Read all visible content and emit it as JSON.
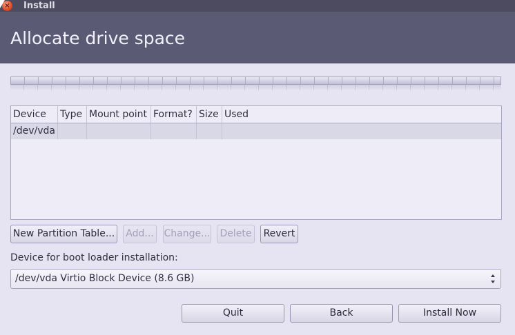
{
  "window": {
    "title": "Install",
    "close_icon": "close-icon"
  },
  "header": {
    "title": "Allocate drive space"
  },
  "table": {
    "columns": [
      "Device",
      "Type",
      "Mount point",
      "Format?",
      "Size",
      "Used"
    ],
    "rows": [
      {
        "device": "/dev/vda",
        "type": "",
        "mount": "",
        "format": "",
        "size": "",
        "used": ""
      }
    ]
  },
  "partition_buttons": {
    "new_table": "New Partition Table...",
    "add": "Add...",
    "change": "Change...",
    "delete": "Delete",
    "revert": "Revert"
  },
  "bootloader": {
    "label": "Device for boot loader installation:",
    "selected": "/dev/vda Virtio Block Device (8.6 GB)"
  },
  "footer": {
    "quit": "Quit",
    "back": "Back",
    "install": "Install Now"
  },
  "colors": {
    "header_bg": "#5a5a75",
    "titlebar_bg": "#4c4b5f",
    "content_bg": "#e6e4f2",
    "close_button": "#df4a26"
  }
}
